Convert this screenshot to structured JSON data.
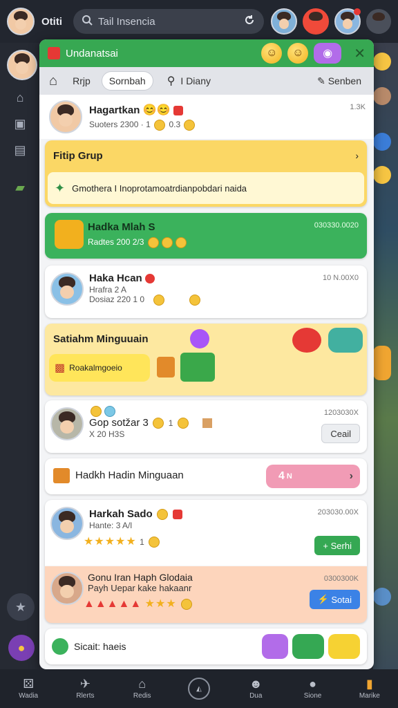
{
  "topbar": {
    "title": "Otiti",
    "search_placeholder": "Tail Insencia"
  },
  "panel": {
    "title": "Undanatsai",
    "tabs": [
      {
        "label": "Rrjp"
      },
      {
        "label": "Sornbah"
      },
      {
        "label": "I Diany"
      },
      {
        "label": "Senben"
      }
    ]
  },
  "feed": {
    "card1": {
      "name": "Hagartkan",
      "sub": "Suoters 2300",
      "count1": "1",
      "count2": "0.3",
      "meta": "1.3K"
    },
    "group": {
      "title": "Fitip Grup",
      "banner": "Gmothera I Inoprotamoatrdianpobdari naida"
    },
    "green": {
      "name": "Hadka Mlah S",
      "sub": "Radtes 200 2/3",
      "meta": "030330.0020"
    },
    "card3": {
      "name": "Haka Hcan",
      "line2": "Hrafra 2 A",
      "sub": "Dosiaz 220 1 0",
      "meta": "10 N.00X0"
    },
    "mission": {
      "title": "Satiahm Minguuain",
      "button": "Roakalmgoeio"
    },
    "card4": {
      "name": "Gop sotžar 3",
      "count": "1",
      "sub": "X 20 H3S",
      "meta": "1203030X",
      "button": "Ceail"
    },
    "hadin": {
      "label": "Hadkh Hadin Minguaan",
      "pill": "4",
      "pill_sub": "N"
    },
    "card5": {
      "name": "Harkah Sado",
      "sub": "Hante: 3 A/l",
      "count": "1",
      "meta": "203030.00X",
      "button": "Serhi"
    },
    "card6": {
      "name": "Gonu Iran Haph Glodaia",
      "sub": "Payh Uepar kake hakaanr",
      "meta": "0300300K",
      "button": "Sotai"
    },
    "card7": {
      "label": "Sicait: haeis"
    }
  },
  "bottomnav": [
    {
      "label": "Wadia",
      "icon": "dice-icon"
    },
    {
      "label": "Rlerts",
      "icon": "plane-icon"
    },
    {
      "label": "Redis",
      "icon": "shop-icon"
    },
    {
      "label": "",
      "icon": "home-circle-icon"
    },
    {
      "label": "Dua",
      "icon": "cat-icon"
    },
    {
      "label": "Sione",
      "icon": "person-icon"
    },
    {
      "label": "Marike",
      "icon": "market-icon"
    }
  ]
}
